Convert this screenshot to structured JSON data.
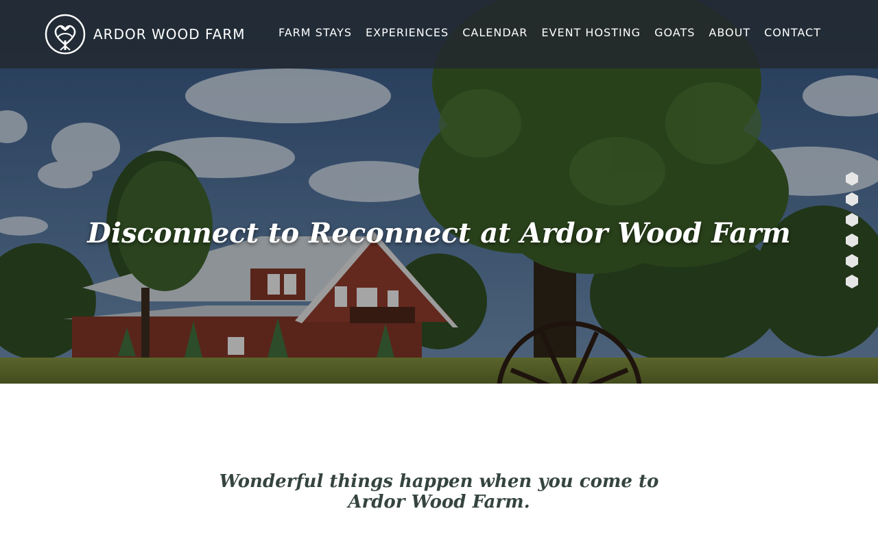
{
  "brand": {
    "name": "ARDOR WOOD FARM",
    "logo_icon": "celtic-heart-tree-logo-icon"
  },
  "nav": {
    "links": [
      {
        "label": "FARM STAYS"
      },
      {
        "label": "EXPERIENCES"
      },
      {
        "label": "CALENDAR"
      },
      {
        "label": "EVENT HOSTING"
      },
      {
        "label": "GOATS"
      },
      {
        "label": "ABOUT"
      },
      {
        "label": "CONTACT"
      }
    ]
  },
  "hero": {
    "title": "Disconnect to Reconnect at Ardor Wood Farm",
    "slide_count": 6,
    "slide_dot_icon": "hexagon-icon"
  },
  "intro": {
    "heading": "Wonderful things happen when you come to Ardor Wood Farm."
  },
  "colors": {
    "navbar_bg": "#22282e",
    "heading_text": "#35443f",
    "dot_fill": "#e6e6e6"
  }
}
